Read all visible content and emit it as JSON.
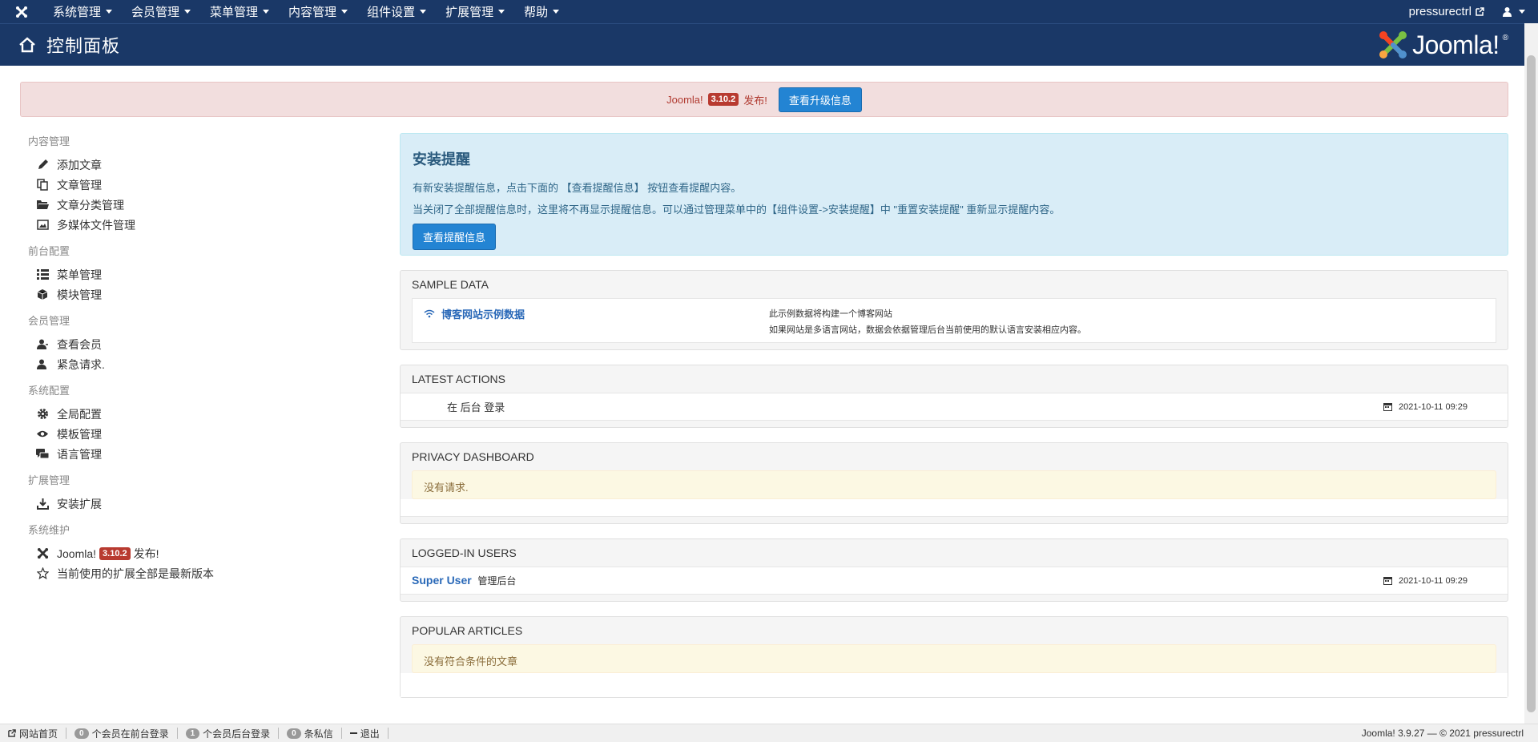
{
  "navbar": {
    "menus": [
      {
        "label": "系统管理"
      },
      {
        "label": "会员管理"
      },
      {
        "label": "菜单管理"
      },
      {
        "label": "内容管理"
      },
      {
        "label": "组件设置"
      },
      {
        "label": "扩展管理"
      },
      {
        "label": "帮助"
      }
    ],
    "user_site": "pressurectrl"
  },
  "header": {
    "title": "控制面板",
    "brand": "Joomla!",
    "brand_mark": "®"
  },
  "update_alert": {
    "prefix": "Joomla!",
    "version": "3.10.2",
    "suffix": "发布!",
    "button": "查看升级信息"
  },
  "sidebar": {
    "sections": [
      {
        "heading": "内容管理",
        "items": [
          "添加文章",
          "文章管理",
          "文章分类管理",
          "多媒体文件管理"
        ]
      },
      {
        "heading": "前台配置",
        "items": [
          "菜单管理",
          "模块管理"
        ]
      },
      {
        "heading": "会员管理",
        "items": [
          "查看会员",
          "紧急请求."
        ]
      },
      {
        "heading": "系统配置",
        "items": [
          "全局配置",
          "模板管理",
          "语言管理"
        ]
      },
      {
        "heading": "扩展管理",
        "items": [
          "安装扩展"
        ]
      },
      {
        "heading": "系统维护",
        "items": []
      }
    ],
    "maintenance": {
      "update_prefix": "Joomla!",
      "update_version": "3.10.2",
      "update_suffix": "发布!",
      "ext_status": "当前使用的扩展全部是最新版本"
    }
  },
  "install_box": {
    "title": "安装提醒",
    "line1": "有新安装提醒信息，点击下面的 【查看提醒信息】 按钮查看提醒内容。",
    "line2": "当关闭了全部提醒信息时，这里将不再显示提醒信息。可以通过管理菜单中的【组件设置->安装提醒】中 \"重置安装提醒\" 重新显示提醒内容。",
    "button": "查看提醒信息"
  },
  "sample_data": {
    "heading": "SAMPLE DATA",
    "link": "博客网站示例数据",
    "desc1": "此示例数据将构建一个博客网站",
    "desc2": "如果网站是多语言网站，数据会依据管理后台当前使用的默认语言安装相应内容。"
  },
  "latest_actions": {
    "heading": "LATEST ACTIONS",
    "action": "在 后台 登录",
    "date": "2021-10-11 09:29"
  },
  "privacy": {
    "heading": "PRIVACY DASHBOARD",
    "message": "没有请求."
  },
  "logged_in": {
    "heading": "LOGGED-IN USERS",
    "user": "Super User",
    "location": "管理后台",
    "date": "2021-10-11 09:29"
  },
  "popular": {
    "heading": "POPULAR ARTICLES",
    "message": "没有符合条件的文章"
  },
  "statusbar": {
    "site": "网站首页",
    "front_count": "0",
    "front_label": "个会员在前台登录",
    "back_count": "1",
    "back_label": "个会员后台登录",
    "msg_count": "0",
    "msg_label": "条私信",
    "logout": "退出",
    "version": "Joomla! 3.9.27 — © 2021 pressurectrl"
  }
}
